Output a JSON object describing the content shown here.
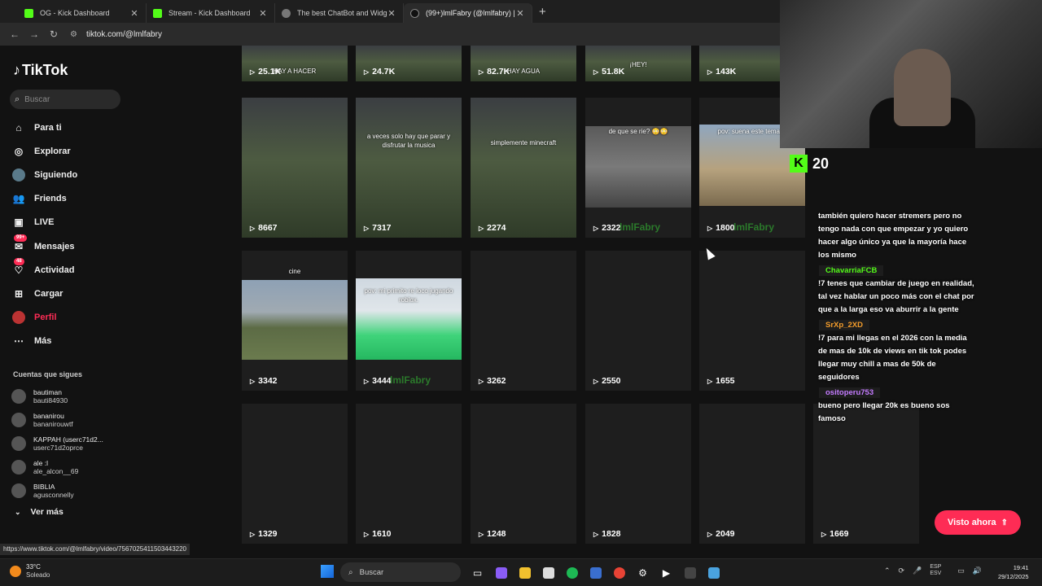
{
  "browser": {
    "tabs": [
      {
        "title": "OG - Kick Dashboard",
        "icon": "kick"
      },
      {
        "title": "Stream - Kick Dashboard",
        "icon": "kick"
      },
      {
        "title": "The best ChatBot and Widgets",
        "icon": "bot"
      },
      {
        "title": "(99+)lmlFabry (@lmlfabry) | Tik",
        "icon": "tiktok"
      }
    ],
    "url": "tiktok.com/@lmlfabry",
    "status_url": "https://www.tiktok.com/@lmlfabry/video/7567025411503443220"
  },
  "sidebar": {
    "brand": "TikTok",
    "search_placeholder": "Buscar",
    "nav": [
      {
        "label": "Para ti",
        "icon": "home-icon"
      },
      {
        "label": "Explorar",
        "icon": "compass-icon"
      },
      {
        "label": "Siguiendo",
        "icon": "following-icon"
      },
      {
        "label": "Friends",
        "icon": "friends-icon"
      },
      {
        "label": "LIVE",
        "icon": "live-icon"
      },
      {
        "label": "Mensajes",
        "icon": "messages-icon",
        "badge": "99+"
      },
      {
        "label": "Actividad",
        "icon": "activity-icon",
        "badge": "48"
      },
      {
        "label": "Cargar",
        "icon": "upload-icon"
      },
      {
        "label": "Perfil",
        "icon": "profile-icon"
      },
      {
        "label": "Más",
        "icon": "more-icon"
      }
    ],
    "following_title": "Cuentas que sigues",
    "following": [
      {
        "name": "bautiman",
        "handle": "bauti84930"
      },
      {
        "name": "bananirou",
        "handle": "bananirouwtf"
      },
      {
        "name": "KAPPAH (userc71d2...",
        "handle": "userc71d2oprce"
      },
      {
        "name": "ale :l",
        "handle": "ale_alcon__69"
      },
      {
        "name": "BIBLIA",
        "handle": "agusconnelly"
      }
    ],
    "more_label": "Ver más"
  },
  "videos": {
    "row0": [
      {
        "views": "25.1K",
        "caption": "HAY A HACER"
      },
      {
        "views": "24.7K",
        "caption": ""
      },
      {
        "views": "82.7K",
        "caption": "HAY AGUA"
      },
      {
        "views": "51.8K",
        "caption": "¡HEY!"
      },
      {
        "views": "143K",
        "caption": ""
      }
    ],
    "row1": [
      {
        "views": "8667",
        "caption": ""
      },
      {
        "views": "7317",
        "caption": "a veces solo hay que parar y disfrutar la musica"
      },
      {
        "views": "2274",
        "caption": "simplemente minecraft"
      },
      {
        "views": "2322",
        "caption": "de que se rie? 😳😳"
      },
      {
        "views": "1800",
        "caption": "pov: suena este temazo"
      }
    ],
    "row2": [
      {
        "views": "3342",
        "caption": "cine"
      },
      {
        "views": "3444",
        "caption": "pov: mi primito re loco jugando roblox."
      },
      {
        "views": "3262",
        "caption": ""
      },
      {
        "views": "2550",
        "caption": ""
      },
      {
        "views": "1655",
        "caption": ""
      }
    ],
    "row3": [
      {
        "views": "1329"
      },
      {
        "views": "1610"
      },
      {
        "views": "1248"
      },
      {
        "views": "1828"
      },
      {
        "views": "2049"
      },
      {
        "views": "1669"
      }
    ],
    "watermark": "lmlFabry"
  },
  "watched_button": "Visto ahora",
  "overlay": {
    "kick_count": "20",
    "chat": [
      {
        "user": "",
        "text": "también quiero hacer stremers pero no tengo nada con que empezar y yo quiero hacer algo único ya que la mayoría hace los mismo"
      },
      {
        "user": "ChavarriaFCB",
        "text": "!7 tenes que cambiar de juego en realidad, tal vez hablar un poco más con el chat por que a la larga eso va aburrir a la gente"
      },
      {
        "user": "SrXp_2XD",
        "text": "!7 para mi llegas en el 2026 con la media de mas de 10k de views en tik tok podes llegar muy chill a mas de 50k de seguidores"
      },
      {
        "user": "ositoperu753",
        "text": "bueno pero llegar 20k es bueno sos famoso"
      }
    ]
  },
  "taskbar": {
    "temp": "33°C",
    "weather": "Soleado",
    "search": "Buscar",
    "lang1": "ESP",
    "lang2": "ESV",
    "time": "19:41",
    "date": "29/12/2025"
  },
  "colors": {
    "accent": "#fe2c55",
    "kick": "#53fc18",
    "bg": "#121212"
  }
}
